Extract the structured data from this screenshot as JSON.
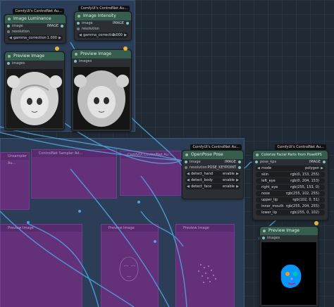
{
  "brand_tag": "ComfyUI's ControlNet Au...",
  "nodes": {
    "luminance": {
      "title": "Image Luminance",
      "input": "image",
      "output": "IMAGE",
      "field1": "resolution",
      "gamma_label": "gamma_correction",
      "gamma_value": "1.000"
    },
    "intensity": {
      "title": "Image Intensity",
      "input": "image",
      "output": "IMAGE",
      "field1": "resolution",
      "gamma_label": "gamma_correction",
      "gamma_value": "1.000"
    },
    "preview1": {
      "title": "Preview Image",
      "input": "images"
    },
    "preview2": {
      "title": "Preview Image",
      "input": "images"
    },
    "openpose": {
      "title": "OpenPose Pose",
      "input": "image",
      "output1": "IMAGE",
      "input2": "resolution",
      "output2": "POSE_KEYPOINT",
      "widgets": [
        {
          "label": "detect_hand",
          "value": "enable"
        },
        {
          "label": "detect_body",
          "value": "enable"
        },
        {
          "label": "detect_face",
          "value": "enable"
        }
      ]
    },
    "colorizer": {
      "title": "Colorize Facial Parts from PoseKPS",
      "input": "pose_kps",
      "output": "IMAGE",
      "widgets": [
        {
          "label": "mode",
          "value": "polygon"
        },
        {
          "label": "skin",
          "value": "rgb(0, 153, 255)"
        },
        {
          "label": "left_eye",
          "value": "rgb(0, 204, 153)"
        },
        {
          "label": "right_eye",
          "value": "rgb(255, 153, 0)"
        },
        {
          "label": "nose",
          "value": "rgb(255, 102, 255)"
        },
        {
          "label": "upper_lip",
          "value": "rgb(102, 0, 51)"
        },
        {
          "label": "inner_mouth",
          "value": "rgb(255, 204, 255)"
        },
        {
          "label": "lower_lip",
          "value": "rgb(255, 0, 102)"
        }
      ]
    },
    "preview3": {
      "title": "Preview Image",
      "input": "images"
    }
  },
  "bg_nodes": [
    {
      "title": "Unsampler Au..."
    },
    {
      "title": "ControlNet Sampler Ad..."
    },
    {
      "title": "ComfyUI ControlNet Au..."
    },
    {
      "title": "Preview Image"
    },
    {
      "title": "Preview Image"
    },
    {
      "title": "Preview Image"
    }
  ],
  "colors": {
    "accent_green": "#355e4f",
    "link_blue": "#4ca3dd",
    "group": "#2c3e57",
    "purple": "#6a2f7e"
  }
}
